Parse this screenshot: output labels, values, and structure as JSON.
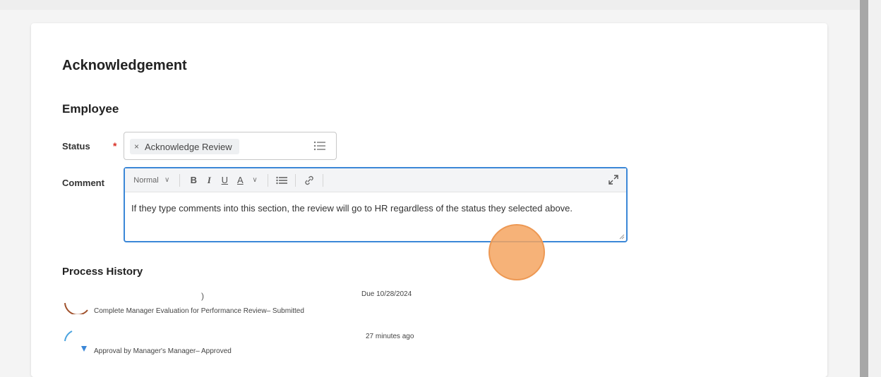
{
  "section": {
    "title": "Acknowledgement",
    "subtitle": "Employee"
  },
  "status": {
    "label": "Status",
    "required_mark": "*",
    "selected_value": "Acknowledge Review",
    "remove_glyph": "×",
    "icon": "list-icon"
  },
  "comment": {
    "label": "Comment",
    "toolbar": {
      "format_label": "Normal",
      "bold_label": "B",
      "italic_label": "I",
      "underline_label": "U",
      "color_label": "A",
      "chevron_glyph": "∨",
      "icons": [
        "bulleted-list-icon",
        "link-icon",
        "expand-icon"
      ]
    },
    "text": "If they type comments into this section, the review will go to HR regardless of the status they selected above."
  },
  "process_history": {
    "title": "Process History",
    "items": [
      {
        "step": "Complete Manager Evaluation for Performance Review",
        "separator": "– ",
        "status": "Submitted",
        "time": "Due 10/28/2024",
        "trailing": ")"
      },
      {
        "step": "Approval by Manager's Manager",
        "separator": "– ",
        "status": "Approved",
        "time": "27 minutes ago"
      }
    ]
  },
  "colors": {
    "accent": "#3b87d7",
    "required": "#d93025",
    "cursor_highlight": "#f5a460"
  }
}
